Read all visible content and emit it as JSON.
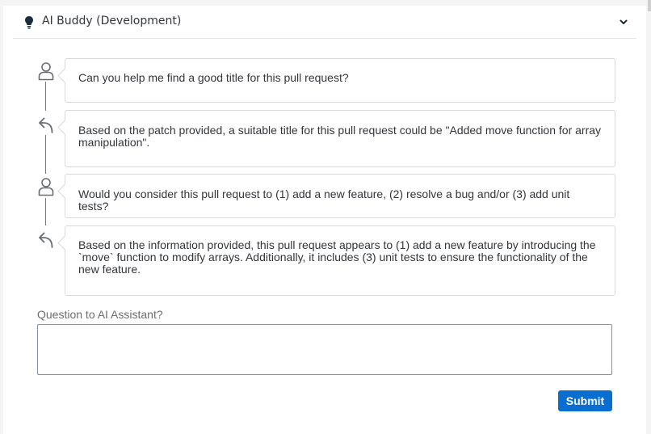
{
  "header": {
    "title": "AI Buddy (Development)",
    "icon": "lightbulb-icon",
    "toggle_icon": "chevron-down-icon"
  },
  "conversation": [
    {
      "role": "user",
      "icon": "user-icon",
      "text": "Can you help me find a good title for this pull request?"
    },
    {
      "role": "assistant",
      "icon": "reply-icon",
      "text": "Based on the patch provided, a suitable title for this pull request could be \"Added move function for array\nmanipulation\"."
    },
    {
      "role": "user",
      "icon": "user-icon",
      "text": "Would you consider this pull request to (1) add a new feature, (2) resolve a bug and/or (3) add unit tests?"
    },
    {
      "role": "assistant",
      "icon": "reply-icon",
      "text": "Based on the information provided, this pull request appears to (1) add a new feature by introducing the\n`move` function to modify arrays. Additionally, it includes (3) unit tests to ensure the functionality of the\nnew feature."
    }
  ],
  "question": {
    "label": "Question to AI Assistant?",
    "value": ""
  },
  "submit_label": "Submit",
  "colors": {
    "accent": "#0a6ed1",
    "text": "#32363a",
    "border": "#d9d9d9"
  }
}
